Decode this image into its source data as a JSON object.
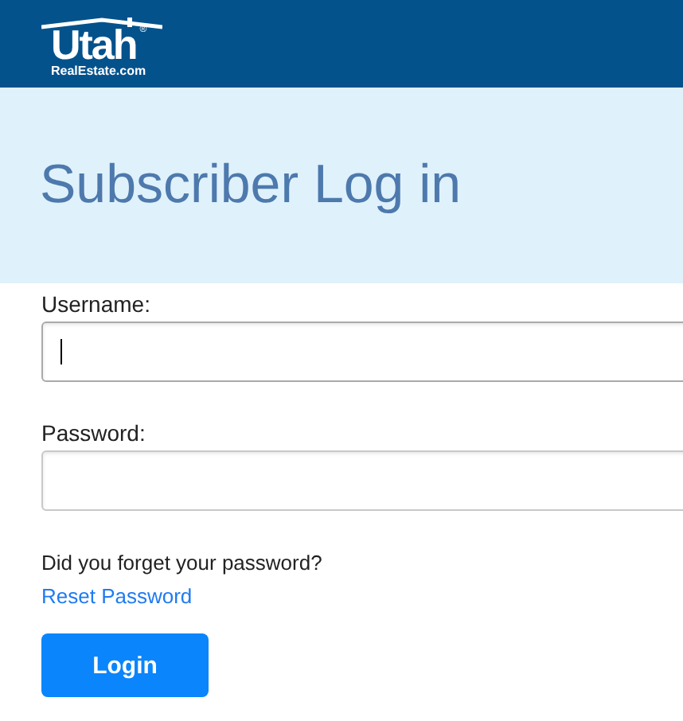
{
  "header": {
    "logo": {
      "name": "Utah",
      "sub": "RealEstate.com",
      "mark": "®"
    }
  },
  "title": "Subscriber Log in",
  "fields": [
    {
      "label": "Username:",
      "focused": true
    },
    {
      "label": "Password:",
      "focused": false
    }
  ],
  "forgot": {
    "question": "Did you forget your password?",
    "link": "Reset Password"
  },
  "button": "Login"
}
